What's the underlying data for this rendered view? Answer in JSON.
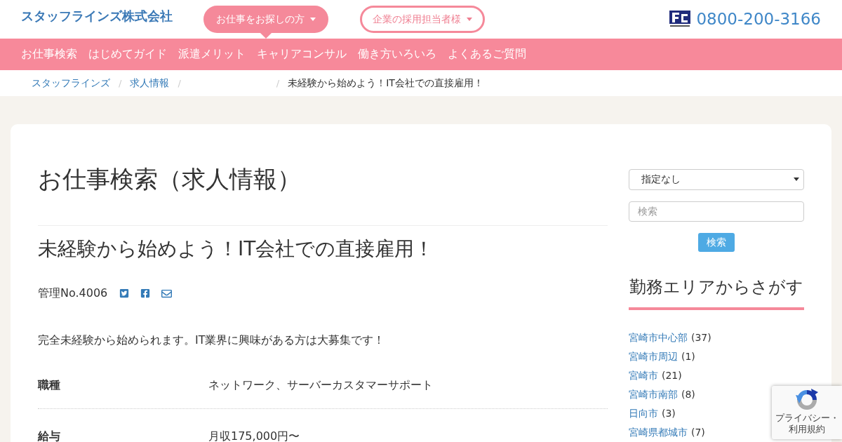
{
  "header": {
    "logo": "スタッフラインズ株式会社",
    "audience_tabs": [
      {
        "label": "お仕事をお探しの方",
        "selected": true
      },
      {
        "label": "企業の採用担当者様",
        "selected": false
      }
    ],
    "phone": "0800-200-3166"
  },
  "nav": {
    "items": [
      "お仕事検索",
      "はじめてガイド",
      "派遣メリット",
      "キャリアコンサル",
      "働き方いろいろ",
      "よくあるご質問"
    ]
  },
  "breadcrumb": {
    "separator": "/",
    "items": [
      {
        "kind": "link",
        "label": "スタッフラインズ"
      },
      {
        "kind": "link",
        "label": "求人情報"
      },
      {
        "kind": "blank"
      },
      {
        "kind": "current",
        "label": "未経験から始めよう！IT会社での直接雇用！"
      }
    ]
  },
  "main": {
    "page_title": "お仕事検索（求人情報）",
    "job_title": "未経験から始めよう！IT会社での直接雇用！",
    "management_no": "管理No.4006",
    "description": "完全未経験から始められます。IT業界に興味がある方は大募集です！",
    "details": [
      {
        "label": "職種",
        "value": "ネットワーク、サーバーカスタマーサポート"
      },
      {
        "label": "給与",
        "value": "月収175,000円〜"
      }
    ]
  },
  "sidebar": {
    "area_select": {
      "value": "指定なし"
    },
    "search": {
      "placeholder": "検索"
    },
    "search_button": "検索",
    "area_heading": "勤務エリアからさがす",
    "areas": [
      {
        "name": "宮崎市中心部",
        "count": "(37)"
      },
      {
        "name": "宮崎市周辺",
        "count": "(1)"
      },
      {
        "name": "宮崎市",
        "count": "(21)"
      },
      {
        "name": "宮崎市南部",
        "count": "(8)"
      },
      {
        "name": "日向市",
        "count": "(3)"
      },
      {
        "name": "宮崎県都城市",
        "count": "(7)"
      }
    ]
  },
  "recaptcha": {
    "caption": "プライバシー・利用規約"
  }
}
